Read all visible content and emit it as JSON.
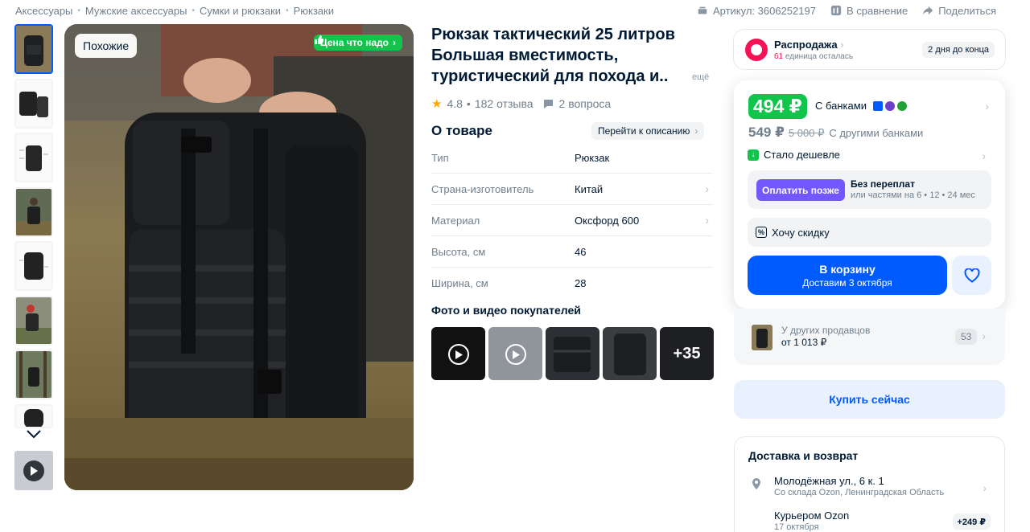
{
  "breadcrumbs": [
    "Аксессуары",
    "Мужские аксессуары",
    "Сумки и рюкзаки",
    "Рюкзаки"
  ],
  "top_actions": {
    "article": "Артикул: 3606252197",
    "compare": "В сравнение",
    "share": "Поделиться"
  },
  "gallery": {
    "similar_label": "Похожие",
    "price_badge": "Цена что надо"
  },
  "product": {
    "title_line1": "Рюкзак тактический 25 литров",
    "title_line2": "Большая вместимость,",
    "title_line3": "туристический для похода и..",
    "title_more": "ещё",
    "rating": "4.8",
    "reviews": "182 отзыва",
    "questions": "2 вопроса"
  },
  "about": {
    "title": "О товаре",
    "link": "Перейти к описанию",
    "specs": [
      {
        "key": "Тип",
        "value": "Рюкзак"
      },
      {
        "key": "Страна-изготовитель",
        "value": "Китай"
      },
      {
        "key": "Материал",
        "value": "Оксфорд 600"
      },
      {
        "key": "Высота, см",
        "value": "46"
      },
      {
        "key": "Ширина, см",
        "value": "28"
      }
    ]
  },
  "buyer_media": {
    "title": "Фото и видео покупателей",
    "more_count": "+35"
  },
  "sale": {
    "title": "Распродажа",
    "count": "61",
    "units_left": "единица осталась",
    "days_left": "2 дня до конца"
  },
  "price": {
    "main": "494 ₽",
    "with_banks": "С банками",
    "other_price": "549 ₽",
    "old_price": "5 000 ₽",
    "other_banks": "С другими банками",
    "cheaper": "Стало дешевле"
  },
  "pay_later": {
    "button": "Оплатить позже",
    "line1": "Без переплат",
    "line2": "или частями на 6 • 12 • 24 мес"
  },
  "discount": {
    "label": "Хочу скидку"
  },
  "cart": {
    "label": "В корзину",
    "delivery": "Доставим 3 октября"
  },
  "sellers": {
    "label": "У других продавцов",
    "from": "от 1 013 ₽",
    "count": "53"
  },
  "buy_now": "Купить сейчас",
  "delivery": {
    "title": "Доставка и возврат",
    "address": "Молодёжная ул., 6 к. 1",
    "warehouse": "Со склада Ozon, Ленинградская Область",
    "courier": "Курьером Ozon",
    "courier_date": "17 октября",
    "courier_price": "+249 ₽"
  },
  "colors": {
    "accent": "#005bff",
    "green": "#10c44c",
    "sale_pink": "#f91155",
    "pay_later": "#7357ff"
  }
}
